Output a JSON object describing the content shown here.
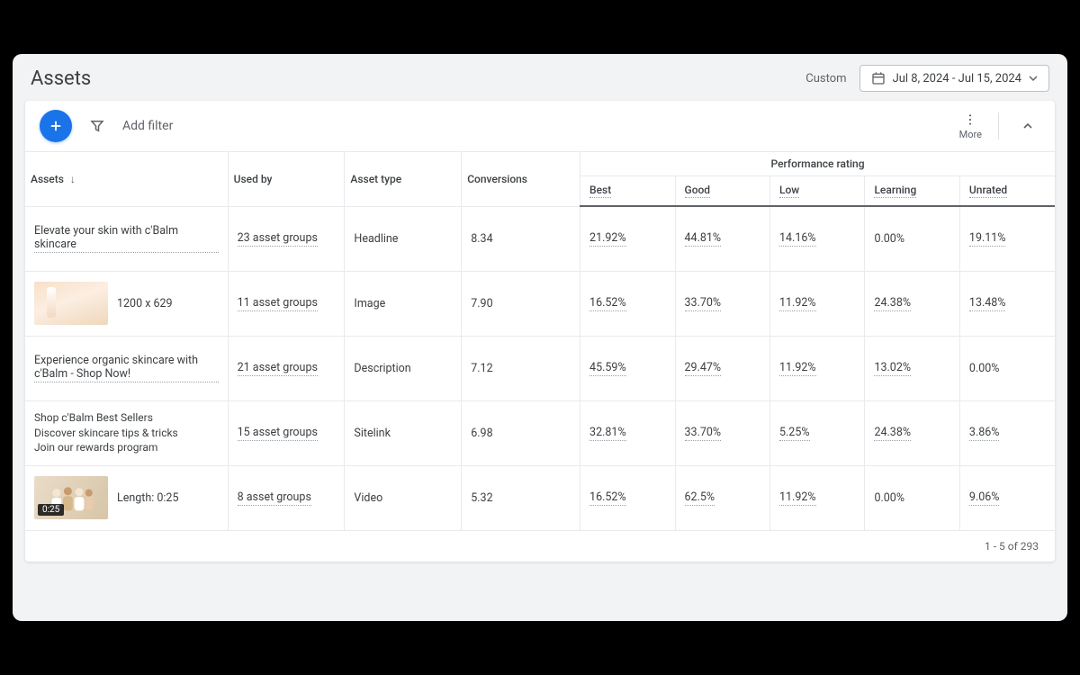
{
  "header": {
    "title": "Assets",
    "custom_label": "Custom",
    "date_range": "Jul 8, 2024 - Jul 15, 2024"
  },
  "toolbar": {
    "add_filter_placeholder": "Add filter",
    "more_label": "More"
  },
  "columns": {
    "assets": "Assets",
    "used_by": "Used by",
    "asset_type": "Asset type",
    "conversions": "Conversions",
    "performance_group": "Performance rating",
    "best": "Best",
    "good": "Good",
    "low": "Low",
    "learning": "Learning",
    "unrated": "Unrated"
  },
  "rows": [
    {
      "asset_label": "Elevate your skin with c'Balm skincare",
      "used_by": "23 asset groups",
      "asset_type": "Headline",
      "conversions": "8.34",
      "best": "21.92%",
      "good": "44.81%",
      "low": "14.16%",
      "learning": "0.00%",
      "unrated": "19.11%"
    },
    {
      "asset_label": "1200 x 629",
      "used_by": "11 asset groups",
      "asset_type": "Image",
      "conversions": "7.90",
      "best": "16.52%",
      "good": "33.70%",
      "low": "11.92%",
      "learning": "24.38%",
      "unrated": "13.48%"
    },
    {
      "asset_label": "Experience organic skincare with c'Balm - Shop Now!",
      "used_by": "21 asset groups",
      "asset_type": "Description",
      "conversions": "7.12",
      "best": "45.59%",
      "good": "29.47%",
      "low": "11.92%",
      "learning": "13.02%",
      "unrated": "0.00%"
    },
    {
      "sitelink_lines": [
        "Shop c'Balm Best Sellers",
        "Discover skincare tips & tricks",
        "Join our rewards program"
      ],
      "used_by": "15 asset groups",
      "asset_type": "Sitelink",
      "conversions": "6.98",
      "best": "32.81%",
      "good": "33.70%",
      "low": "5.25%",
      "learning": "24.38%",
      "unrated": "3.86%"
    },
    {
      "asset_label": "Length: 0:25",
      "video_badge": "0:25",
      "used_by": "8 asset groups",
      "asset_type": "Video",
      "conversions": "5.32",
      "best": "16.52%",
      "good": "62.5%",
      "low": "11.92%",
      "learning": "0.00%",
      "unrated": "9.06%"
    }
  ],
  "pager": "1 - 5 of 293"
}
